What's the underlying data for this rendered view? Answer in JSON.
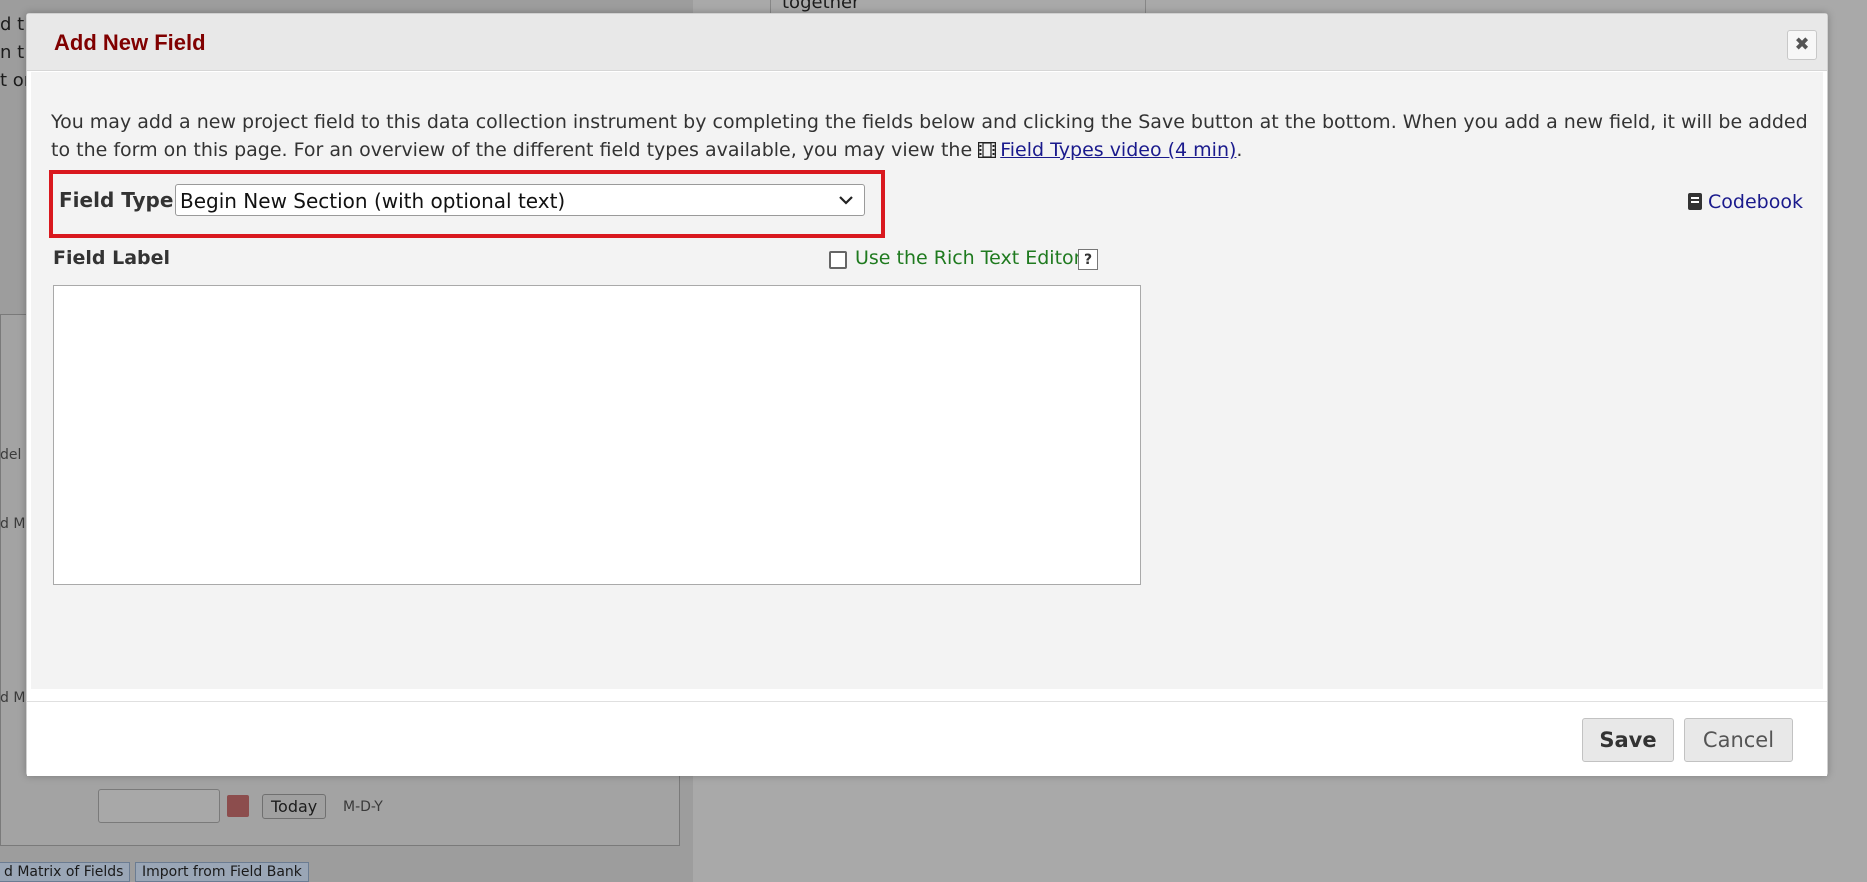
{
  "background": {
    "fragments": [
      "d t",
      "n t",
      "t or",
      "together",
      "del",
      "d Ma",
      "d Ma"
    ],
    "date": {
      "today_label": "Today",
      "format_label": "M-D-Y"
    },
    "buttons": {
      "add_matrix": "d Matrix of Fields",
      "import_bank": "Import from Field Bank"
    }
  },
  "modal": {
    "title": "Add New Field",
    "close_symbol": "✖",
    "intro_text": "You may add a new project field to this data collection instrument by completing the fields below and clicking the Save button at the bottom. When you add a new field, it will be added to the form on this page. For an overview of the different field types available, you may view the",
    "video_link": "Field Types video (4 min)",
    "intro_end": ".",
    "field_type": {
      "label": "Field Type:",
      "selected": "Begin New Section (with optional text)"
    },
    "codebook_label": "Codebook",
    "field_label_heading": "Field Label",
    "rich_text": {
      "label": "Use the Rich Text Editor",
      "checked": false,
      "help": "?"
    },
    "footer": {
      "save": "Save",
      "cancel": "Cancel"
    }
  },
  "colors": {
    "title": "#800000",
    "highlight_border": "#d9181e",
    "link": "#1a1a8c",
    "rte_label": "#1f7a1f"
  },
  "icons": [
    "close-icon",
    "film-icon",
    "chevron-down-icon",
    "book-icon",
    "help-icon",
    "calendar-icon"
  ]
}
